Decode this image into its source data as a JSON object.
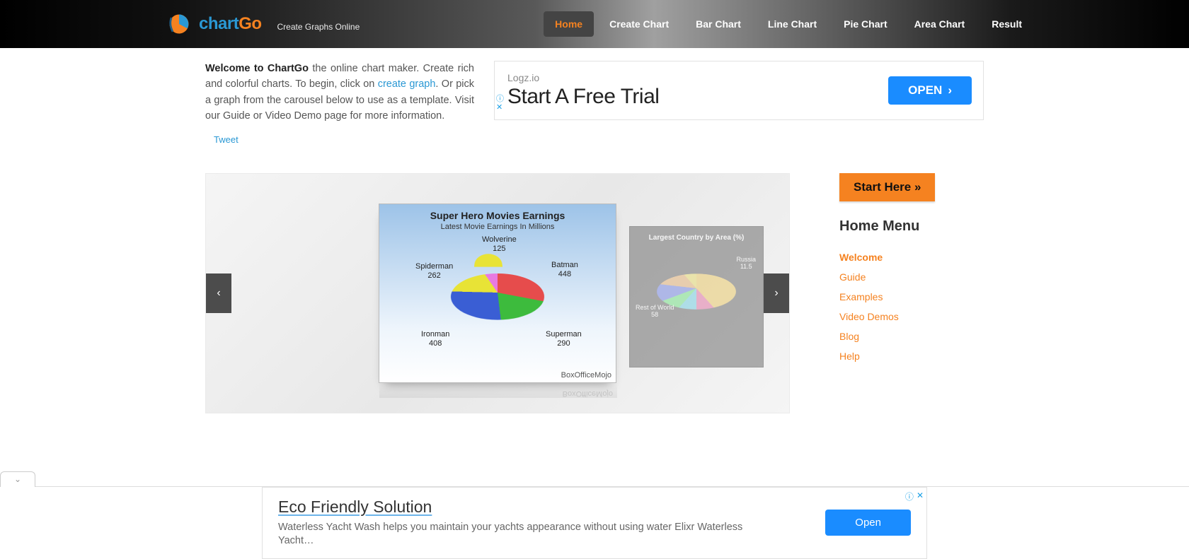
{
  "header": {
    "logo_prefix": "chart",
    "logo_suffix": "Go",
    "tagline": "Create Graphs Online",
    "nav": [
      "Home",
      "Create Chart",
      "Bar Chart",
      "Line Chart",
      "Pie Chart",
      "Area Chart",
      "Result"
    ],
    "nav_active": 0
  },
  "intro": {
    "bold": "Welcome to ChartGo",
    "text1": " the online chart maker. Create rich and colorful charts. To begin, click on ",
    "link": "create graph",
    "text2": ". Or pick a graph from the carousel below to use as a template. Visit our Guide or Video Demo page for more information.",
    "tweet": "Tweet"
  },
  "ad_top": {
    "brand": "Logz.io",
    "headline": "Start A Free Trial",
    "button": "OPEN"
  },
  "carousel": {
    "main": {
      "title": "Super Hero Movies Earnings",
      "subtitle": "Latest Movie Earnings In Millions",
      "source": "BoxOfficeMojo",
      "slices": [
        {
          "label": "Wolverine",
          "value": "125"
        },
        {
          "label": "Batman",
          "value": "448"
        },
        {
          "label": "Superman",
          "value": "290"
        },
        {
          "label": "Ironman",
          "value": "408"
        },
        {
          "label": "Spiderman",
          "value": "262"
        }
      ]
    },
    "side": {
      "title": "Largest Country by Area (%)",
      "labels": {
        "rest": "Rest of World",
        "rest_v": "58",
        "russia": "Russia",
        "russia_v": "11.5"
      }
    }
  },
  "sidebar": {
    "start": "Start Here »",
    "heading": "Home Menu",
    "items": [
      "Welcome",
      "Guide",
      "Examples",
      "Video Demos",
      "Blog",
      "Help"
    ],
    "active": 0
  },
  "ad_bottom": {
    "title": "Eco Friendly Solution",
    "body": "Waterless Yacht Wash helps you maintain your yachts appearance without using water Elixr Waterless Yacht…",
    "button": "Open"
  },
  "chart_data": {
    "type": "pie",
    "title": "Super Hero Movies Earnings",
    "subtitle": "Latest Movie Earnings In Millions",
    "categories": [
      "Wolverine",
      "Batman",
      "Superman",
      "Ironman",
      "Spiderman"
    ],
    "values": [
      125,
      448,
      290,
      408,
      262
    ],
    "source": "BoxOfficeMojo"
  }
}
